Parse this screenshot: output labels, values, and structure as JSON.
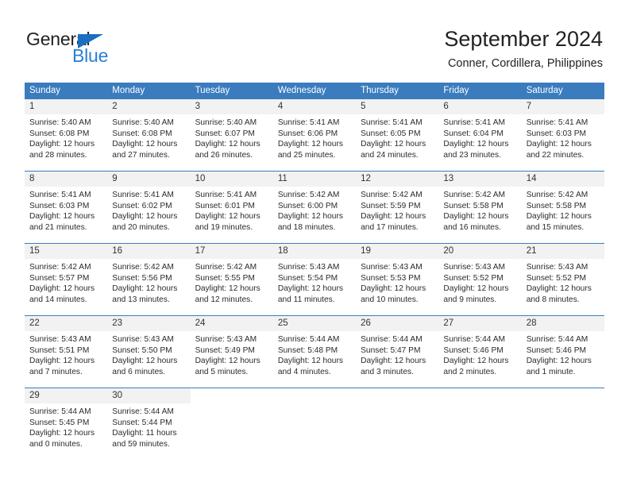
{
  "brand": {
    "name_top": "General",
    "name_bottom": "Blue",
    "accent_color": "#2a7fd4",
    "triangle_color": "#1b6ec2"
  },
  "header": {
    "title": "September 2024",
    "subtitle": "Conner, Cordillera, Philippines"
  },
  "theme": {
    "header_bg": "#3a7cbe",
    "header_text": "#ffffff",
    "daynum_bg": "#f2f2f2",
    "row_divider": "#3a7cbe",
    "body_text": "#2b2b2b"
  },
  "weekdays": [
    "Sunday",
    "Monday",
    "Tuesday",
    "Wednesday",
    "Thursday",
    "Friday",
    "Saturday"
  ],
  "labels": {
    "sunrise_prefix": "Sunrise:",
    "sunset_prefix": "Sunset:",
    "daylight_prefix": "Daylight:"
  },
  "days": [
    {
      "n": "1",
      "sunrise": "Sunrise: 5:40 AM",
      "sunset": "Sunset: 6:08 PM",
      "daylight1": "Daylight: 12 hours",
      "daylight2": "and 28 minutes."
    },
    {
      "n": "2",
      "sunrise": "Sunrise: 5:40 AM",
      "sunset": "Sunset: 6:08 PM",
      "daylight1": "Daylight: 12 hours",
      "daylight2": "and 27 minutes."
    },
    {
      "n": "3",
      "sunrise": "Sunrise: 5:40 AM",
      "sunset": "Sunset: 6:07 PM",
      "daylight1": "Daylight: 12 hours",
      "daylight2": "and 26 minutes."
    },
    {
      "n": "4",
      "sunrise": "Sunrise: 5:41 AM",
      "sunset": "Sunset: 6:06 PM",
      "daylight1": "Daylight: 12 hours",
      "daylight2": "and 25 minutes."
    },
    {
      "n": "5",
      "sunrise": "Sunrise: 5:41 AM",
      "sunset": "Sunset: 6:05 PM",
      "daylight1": "Daylight: 12 hours",
      "daylight2": "and 24 minutes."
    },
    {
      "n": "6",
      "sunrise": "Sunrise: 5:41 AM",
      "sunset": "Sunset: 6:04 PM",
      "daylight1": "Daylight: 12 hours",
      "daylight2": "and 23 minutes."
    },
    {
      "n": "7",
      "sunrise": "Sunrise: 5:41 AM",
      "sunset": "Sunset: 6:03 PM",
      "daylight1": "Daylight: 12 hours",
      "daylight2": "and 22 minutes."
    },
    {
      "n": "8",
      "sunrise": "Sunrise: 5:41 AM",
      "sunset": "Sunset: 6:03 PM",
      "daylight1": "Daylight: 12 hours",
      "daylight2": "and 21 minutes."
    },
    {
      "n": "9",
      "sunrise": "Sunrise: 5:41 AM",
      "sunset": "Sunset: 6:02 PM",
      "daylight1": "Daylight: 12 hours",
      "daylight2": "and 20 minutes."
    },
    {
      "n": "10",
      "sunrise": "Sunrise: 5:41 AM",
      "sunset": "Sunset: 6:01 PM",
      "daylight1": "Daylight: 12 hours",
      "daylight2": "and 19 minutes."
    },
    {
      "n": "11",
      "sunrise": "Sunrise: 5:42 AM",
      "sunset": "Sunset: 6:00 PM",
      "daylight1": "Daylight: 12 hours",
      "daylight2": "and 18 minutes."
    },
    {
      "n": "12",
      "sunrise": "Sunrise: 5:42 AM",
      "sunset": "Sunset: 5:59 PM",
      "daylight1": "Daylight: 12 hours",
      "daylight2": "and 17 minutes."
    },
    {
      "n": "13",
      "sunrise": "Sunrise: 5:42 AM",
      "sunset": "Sunset: 5:58 PM",
      "daylight1": "Daylight: 12 hours",
      "daylight2": "and 16 minutes."
    },
    {
      "n": "14",
      "sunrise": "Sunrise: 5:42 AM",
      "sunset": "Sunset: 5:58 PM",
      "daylight1": "Daylight: 12 hours",
      "daylight2": "and 15 minutes."
    },
    {
      "n": "15",
      "sunrise": "Sunrise: 5:42 AM",
      "sunset": "Sunset: 5:57 PM",
      "daylight1": "Daylight: 12 hours",
      "daylight2": "and 14 minutes."
    },
    {
      "n": "16",
      "sunrise": "Sunrise: 5:42 AM",
      "sunset": "Sunset: 5:56 PM",
      "daylight1": "Daylight: 12 hours",
      "daylight2": "and 13 minutes."
    },
    {
      "n": "17",
      "sunrise": "Sunrise: 5:42 AM",
      "sunset": "Sunset: 5:55 PM",
      "daylight1": "Daylight: 12 hours",
      "daylight2": "and 12 minutes."
    },
    {
      "n": "18",
      "sunrise": "Sunrise: 5:43 AM",
      "sunset": "Sunset: 5:54 PM",
      "daylight1": "Daylight: 12 hours",
      "daylight2": "and 11 minutes."
    },
    {
      "n": "19",
      "sunrise": "Sunrise: 5:43 AM",
      "sunset": "Sunset: 5:53 PM",
      "daylight1": "Daylight: 12 hours",
      "daylight2": "and 10 minutes."
    },
    {
      "n": "20",
      "sunrise": "Sunrise: 5:43 AM",
      "sunset": "Sunset: 5:52 PM",
      "daylight1": "Daylight: 12 hours",
      "daylight2": "and 9 minutes."
    },
    {
      "n": "21",
      "sunrise": "Sunrise: 5:43 AM",
      "sunset": "Sunset: 5:52 PM",
      "daylight1": "Daylight: 12 hours",
      "daylight2": "and 8 minutes."
    },
    {
      "n": "22",
      "sunrise": "Sunrise: 5:43 AM",
      "sunset": "Sunset: 5:51 PM",
      "daylight1": "Daylight: 12 hours",
      "daylight2": "and 7 minutes."
    },
    {
      "n": "23",
      "sunrise": "Sunrise: 5:43 AM",
      "sunset": "Sunset: 5:50 PM",
      "daylight1": "Daylight: 12 hours",
      "daylight2": "and 6 minutes."
    },
    {
      "n": "24",
      "sunrise": "Sunrise: 5:43 AM",
      "sunset": "Sunset: 5:49 PM",
      "daylight1": "Daylight: 12 hours",
      "daylight2": "and 5 minutes."
    },
    {
      "n": "25",
      "sunrise": "Sunrise: 5:44 AM",
      "sunset": "Sunset: 5:48 PM",
      "daylight1": "Daylight: 12 hours",
      "daylight2": "and 4 minutes."
    },
    {
      "n": "26",
      "sunrise": "Sunrise: 5:44 AM",
      "sunset": "Sunset: 5:47 PM",
      "daylight1": "Daylight: 12 hours",
      "daylight2": "and 3 minutes."
    },
    {
      "n": "27",
      "sunrise": "Sunrise: 5:44 AM",
      "sunset": "Sunset: 5:46 PM",
      "daylight1": "Daylight: 12 hours",
      "daylight2": "and 2 minutes."
    },
    {
      "n": "28",
      "sunrise": "Sunrise: 5:44 AM",
      "sunset": "Sunset: 5:46 PM",
      "daylight1": "Daylight: 12 hours",
      "daylight2": "and 1 minute."
    },
    {
      "n": "29",
      "sunrise": "Sunrise: 5:44 AM",
      "sunset": "Sunset: 5:45 PM",
      "daylight1": "Daylight: 12 hours",
      "daylight2": "and 0 minutes."
    },
    {
      "n": "30",
      "sunrise": "Sunrise: 5:44 AM",
      "sunset": "Sunset: 5:44 PM",
      "daylight1": "Daylight: 11 hours",
      "daylight2": "and 59 minutes."
    }
  ],
  "grid": {
    "first_day_column_index": 0,
    "weeks": 5,
    "columns": 7
  }
}
